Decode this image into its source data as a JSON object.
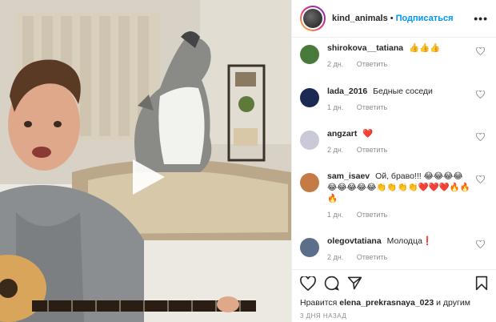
{
  "post": {
    "username": "kind_animals",
    "dot": "•",
    "follow": "Подписаться",
    "more": "•••"
  },
  "comments": [
    {
      "user": "shirokova__tatiana",
      "text": "👍👍👍",
      "age": "2 дн.",
      "reply": "Ответить",
      "avatar_color": "#4a7a3a"
    },
    {
      "user": "lada_2016",
      "text": "Бедные соседи",
      "age": "1 дн.",
      "reply": "Ответить",
      "avatar_color": "#1b2a55"
    },
    {
      "user": "angzart",
      "text": "❤️",
      "age": "2 дн.",
      "reply": "Ответить",
      "avatar_color": "#c9c9d8"
    },
    {
      "user": "sam_isaev",
      "text": "Ой, браво!!! 😂😂😂😂😂😂😂😂😂👏👏👏👏❤️❤️❤️🔥🔥🔥",
      "age": "1 дн.",
      "reply": "Ответить",
      "avatar_color": "#c47b45"
    },
    {
      "user": "olegovtatiana",
      "text": "Молодца❗",
      "age": "2 дн.",
      "reply": "Ответить",
      "avatar_color": "#5c6f8a"
    }
  ],
  "likes": {
    "prefix": "Нравится",
    "user": "elena_prekrasnaya_023",
    "suffix": "и другим"
  },
  "timestamp": "3 ДНЯ НАЗАД",
  "colors": {
    "link": "#0095f6",
    "muted": "#8e8e8e",
    "heart_red": "#ed4956"
  },
  "icons": [
    "play-icon",
    "heart-icon",
    "comment-icon",
    "share-icon",
    "bookmark-icon",
    "more-icon"
  ]
}
